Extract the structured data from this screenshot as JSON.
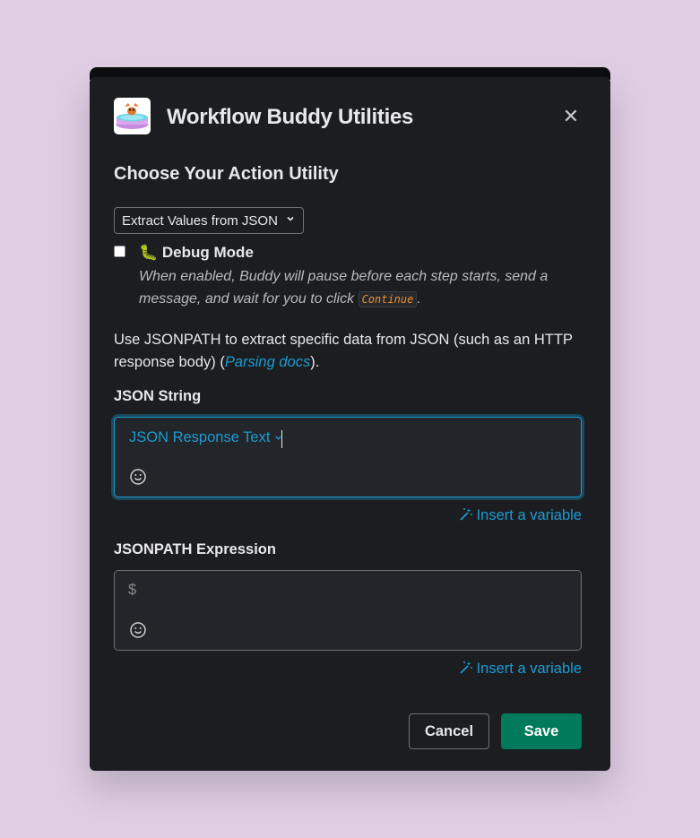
{
  "modal": {
    "title": "Workflow Buddy Utilities",
    "close_symbol": "✕",
    "section_title": "Choose Your Action Utility"
  },
  "utility_select": {
    "selected": "Extract Values from JSON"
  },
  "debug": {
    "checked": false,
    "emoji": "🐛",
    "label": "Debug Mode",
    "desc_part1": "When enabled, Buddy will pause before each step starts, send a message, and wait for you to click ",
    "code": "Continue",
    "desc_part2": "."
  },
  "help": {
    "text_part1": "Use JSONPATH to extract specific data from JSON (such as an HTTP response body) (",
    "link": "Parsing docs",
    "text_part2": ")."
  },
  "json_string": {
    "label": "JSON String",
    "token": "JSON Response Text",
    "insert_variable": "Insert a variable"
  },
  "jsonpath": {
    "label": "JSONPATH Expression",
    "placeholder": "$",
    "insert_variable": "Insert a variable"
  },
  "footer": {
    "cancel": "Cancel",
    "save": "Save"
  },
  "colors": {
    "accent": "#1d9bd1",
    "save": "#007a5a",
    "background": "#dfcde3",
    "modal": "#1b1d21"
  }
}
